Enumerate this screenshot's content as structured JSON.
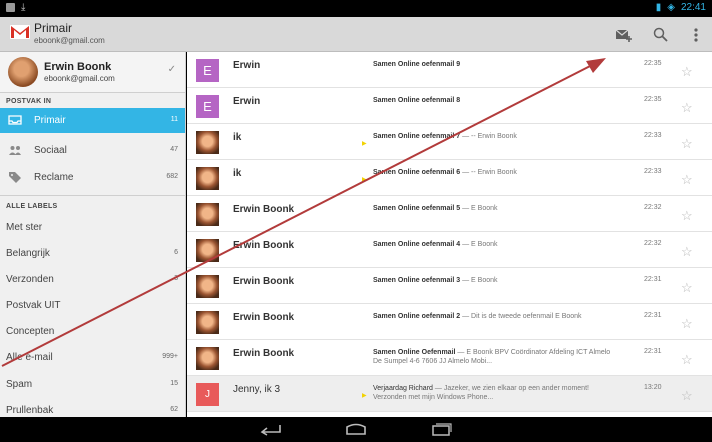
{
  "status_bar": {
    "time": "22:41"
  },
  "header": {
    "title": "Primair",
    "account_email": "eboonk@gmail.com",
    "compose_icon": "compose-icon",
    "search_icon": "search-icon",
    "overflow_icon": "overflow-icon"
  },
  "sidebar": {
    "account": {
      "name": "Erwin Boonk",
      "email": "eboonk@gmail.com"
    },
    "inbox_heading": "POSTVAK IN",
    "inbox_items": [
      {
        "label": "Primair",
        "count": "11",
        "icon": "inbox-icon"
      },
      {
        "label": "Sociaal",
        "count": "47",
        "icon": "people-icon"
      },
      {
        "label": "Reclame",
        "count": "682",
        "icon": "tag-icon"
      }
    ],
    "labels_heading": "ALLE LABELS",
    "label_items": [
      {
        "label": "Met ster",
        "count": ""
      },
      {
        "label": "Belangrijk",
        "count": "6"
      },
      {
        "label": "Verzonden",
        "count": "3"
      },
      {
        "label": "Postvak UIT",
        "count": ""
      },
      {
        "label": "Concepten",
        "count": ""
      },
      {
        "label": "Alle e-mail",
        "count": "999+"
      },
      {
        "label": "Spam",
        "count": "15"
      },
      {
        "label": "Prullenbak",
        "count": "62"
      }
    ]
  },
  "emails": [
    {
      "sender": "Erwin",
      "avatar_letter": "E",
      "subject": "Samen Online oefenmail 9",
      "snippet": "",
      "time": "22:35",
      "important": false,
      "read": false
    },
    {
      "sender": "Erwin",
      "avatar_letter": "E",
      "subject": "Samen Online oefenmail 8",
      "snippet": "",
      "time": "22:35",
      "important": false,
      "read": false
    },
    {
      "sender": "ik",
      "avatar_letter": "",
      "subject": "Samen Online oefenmail 7",
      "snippet": " — -- Erwin Boonk",
      "time": "22:33",
      "important": true,
      "read": false
    },
    {
      "sender": "ik",
      "avatar_letter": "",
      "subject": "Samen Online oefenmail 6",
      "snippet": " — -- Erwin Boonk",
      "time": "22:33",
      "important": true,
      "read": false
    },
    {
      "sender": "Erwin Boonk",
      "avatar_letter": "",
      "subject": "Samen Online oefenmail 5",
      "snippet": " — E Boonk",
      "time": "22:32",
      "important": false,
      "read": false
    },
    {
      "sender": "Erwin Boonk",
      "avatar_letter": "",
      "subject": "Samen Online oefenmail 4",
      "snippet": " — E Boonk",
      "time": "22:32",
      "important": false,
      "read": false
    },
    {
      "sender": "Erwin Boonk",
      "avatar_letter": "",
      "subject": "Samen Online oefenmail 3",
      "snippet": " — E Boonk",
      "time": "22:31",
      "important": false,
      "read": false
    },
    {
      "sender": "Erwin Boonk",
      "avatar_letter": "",
      "subject": "Samen Online oefenmail 2",
      "snippet": " — Dit is de tweede oefenmail E Boonk",
      "time": "22:31",
      "important": false,
      "read": false
    },
    {
      "sender": "Erwin Boonk",
      "avatar_letter": "",
      "subject": "Samen Online Oefenmail",
      "snippet": " — E Boonk BPV Coördinator Afdeling ICT Almelo De Sumpel 4-6 7606 JJ Almelo Mobi...",
      "time": "22:31",
      "important": false,
      "read": false
    },
    {
      "sender": "Jenny, ik  3",
      "avatar_letter": "J",
      "subject": "Verjaardag Richard",
      "snippet": " — Jazeker, we zien elkaar op een ander moment! Verzonden met mijn Windows Phone...",
      "time": "13:20",
      "important": true,
      "read": true
    }
  ],
  "colors": {
    "accent": "#33b5e5",
    "gmail_red": "#d93025",
    "annotation": "#b23b3b"
  }
}
